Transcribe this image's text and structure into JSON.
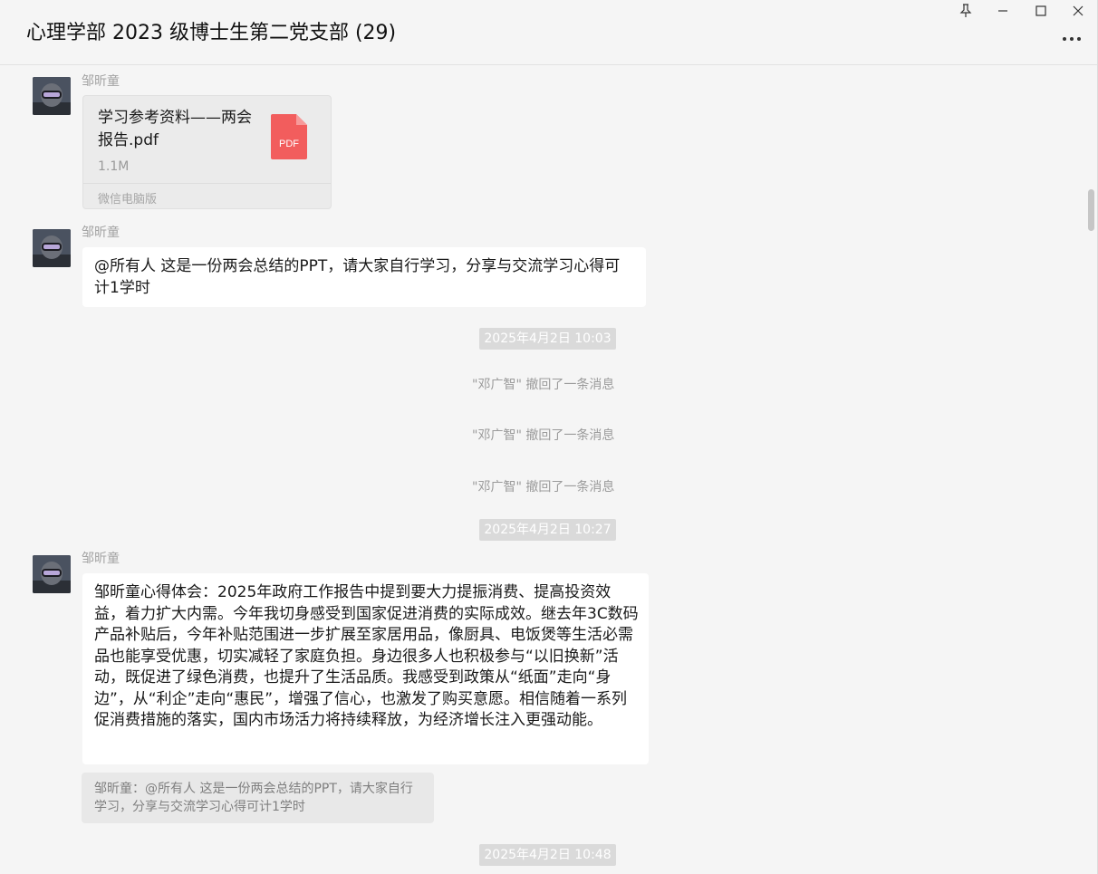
{
  "window": {
    "title": "心理学部 2023 级博士生第二党支部 (29)",
    "pin_icon": "pin-icon",
    "minimize_icon": "minimize-icon",
    "maximize_icon": "maximize-icon",
    "close_icon": "close-icon",
    "more_icon": "more-options-icon"
  },
  "messages": {
    "file_msg": {
      "sender": "邹昕童",
      "file_name": "学习参考资料——两会报告.pdf",
      "file_size": "1.1M",
      "file_type": "PDF",
      "source": "微信电脑版"
    },
    "text_msg_1": {
      "sender": "邹昕童",
      "text": "@所有人 这是一份两会总结的PPT，请大家自行学习，分享与交流学习心得可计1学时"
    },
    "time_1": "2025年4月2日 10:03",
    "recalls": [
      "\"邓广智\" 撤回了一条消息",
      "\"邓广智\" 撤回了一条消息",
      "\"邓广智\" 撤回了一条消息"
    ],
    "time_2": "2025年4月2日 10:27",
    "text_msg_2": {
      "sender": "邹昕童",
      "text": "邹昕童心得体会：2025年政府工作报告中提到要大力提振消费、提高投资效益，着力扩大内需。今年我切身感受到国家促进消费的实际成效。继去年3C数码产品补贴后，今年补贴范围进一步扩展至家居用品，像厨具、电饭煲等生活必需品也能享受优惠，切实减轻了家庭负担。身边很多人也积极参与“以旧换新”活动，既促进了绿色消费，也提升了生活品质。我感受到政策从“纸面”走向“身边”，从“利企”走向“惠民”，增强了信心，也激发了购买意愿。相信随着一系列促消费措施的落实，国内市场活力将持续释放，为经济增长注入更强动能。",
      "quote": "邹昕童：@所有人 这是一份两会总结的PPT，请大家自行学习，分享与交流学习心得可计1学时"
    },
    "time_3": "2025年4月2日 10:48"
  },
  "colors": {
    "background": "#f5f5f5",
    "bubble": "#ffffff",
    "pdf_red": "#f25d5d",
    "time_badge": "#dadada"
  }
}
